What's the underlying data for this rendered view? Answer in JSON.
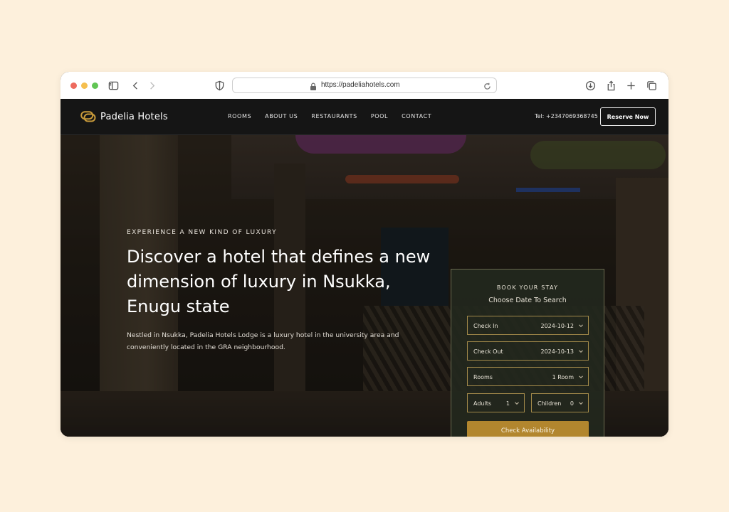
{
  "browser": {
    "url": "https://padeliahotels.com",
    "icons": [
      "sidebar-icon",
      "back-icon",
      "forward-icon",
      "shield-icon",
      "lock-icon",
      "reload-icon",
      "download-icon",
      "share-icon",
      "new-tab-icon",
      "tabs-icon"
    ]
  },
  "nav": {
    "brand": "Padelia Hotels",
    "menu": [
      "ROOMS",
      "ABOUT US",
      "RESTAURANTS",
      "POOL",
      "CONTACT"
    ],
    "tel": "Tel: +2347069368745",
    "reserve_label": "Reserve Now"
  },
  "hero": {
    "eyebrow": "EXPERIENCE A NEW KIND OF LUXURY",
    "headline_lines": [
      "Discover a hotel that defines a new",
      "dimension of luxury in Nsukka,",
      "Enugu state"
    ],
    "sub_lines": [
      "Nestled in Nsukka, Padelia Hotels Lodge is a luxury hotel in the university area and",
      "conveniently located in the GRA neighbourhood."
    ]
  },
  "booking": {
    "title": "BOOK YOUR STAY",
    "subtitle": "Choose Date To Search",
    "check_in": {
      "label": "Check In",
      "value": "2024-10-12"
    },
    "check_out": {
      "label": "Check Out",
      "value": "2024-10-13"
    },
    "rooms": {
      "label": "Rooms",
      "value": "1 Room"
    },
    "adults": {
      "label": "Adults",
      "value": "1"
    },
    "children": {
      "label": "Children",
      "value": "0"
    },
    "button_label": "Check Availability"
  },
  "colors": {
    "page_bg": "#fdf0dc",
    "nav_bg": "#151515",
    "accent_gold": "#b2862e",
    "card_bg": "#23291e"
  }
}
